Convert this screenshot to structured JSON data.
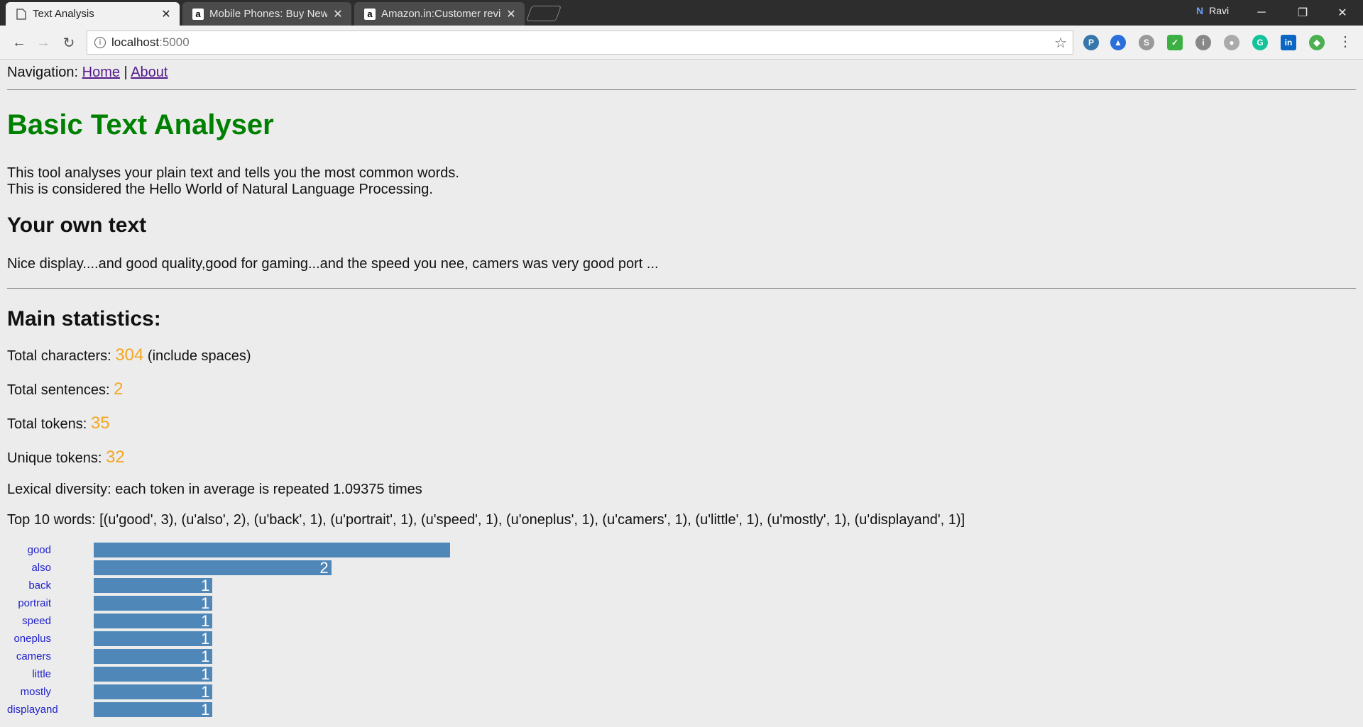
{
  "browser": {
    "tabs": [
      {
        "title": "Text Analysis",
        "active": true,
        "favicon": "page-icon"
      },
      {
        "title": "Mobile Phones: Buy New",
        "active": false,
        "favicon": "amazon-icon"
      },
      {
        "title": "Amazon.in:Customer revi",
        "active": false,
        "favicon": "amazon-icon"
      }
    ],
    "profile_name": "Ravi",
    "url_host": "localhost",
    "url_port": ":5000"
  },
  "page": {
    "nav_label": "Navigation:",
    "nav_home": "Home",
    "nav_sep": "|",
    "nav_about": "About",
    "title": "Basic Text Analyser",
    "intro_line1": "This tool analyses your plain text and tells you the most common words.",
    "intro_line2": "This is considered the Hello World of Natural Language Processing.",
    "own_heading": "Your own text",
    "own_text": "Nice display....and good quality,good for gaming...and the speed you nee, camers was very good port ...",
    "stats_heading": "Main statistics:",
    "total_chars_label": "Total characters:",
    "total_chars": "304",
    "total_chars_suffix": "(include spaces)",
    "total_sentences_label": "Total sentences:",
    "total_sentences": "2",
    "total_tokens_label": "Total tokens:",
    "total_tokens": "35",
    "unique_tokens_label": "Unique tokens:",
    "unique_tokens": "32",
    "lexical": "Lexical diversity: each token in average is repeated 1.09375 times",
    "top_words": "Top 10 words: [(u'good', 3), (u'also', 2), (u'back', 1), (u'portrait', 1), (u'speed', 1), (u'oneplus', 1), (u'camers', 1), (u'little', 1), (u'mostly', 1), (u'displayand', 1)]"
  },
  "chart_data": {
    "type": "bar",
    "orientation": "horizontal",
    "categories": [
      "good",
      "also",
      "back",
      "portrait",
      "speed",
      "oneplus",
      "camers",
      "little",
      "mostly",
      "displayand"
    ],
    "values": [
      3,
      2,
      1,
      1,
      1,
      1,
      1,
      1,
      1,
      1
    ],
    "data_labels": [
      "",
      "2",
      "1",
      "1",
      "1",
      "1",
      "1",
      "1",
      "1",
      "1"
    ],
    "bar_color": "#4f87b8",
    "label_color": "#2222cc"
  },
  "colors": {
    "title": "#008000",
    "number_accent": "#f5a623"
  }
}
